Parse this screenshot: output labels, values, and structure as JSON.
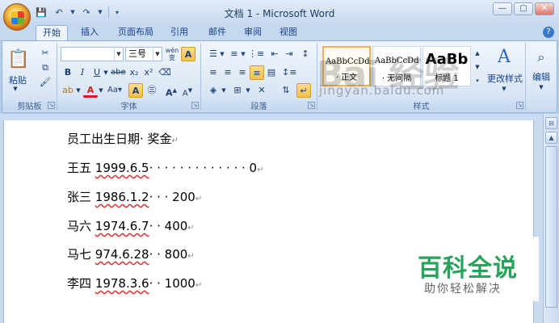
{
  "window": {
    "title": "文档 1 - Microsoft Word",
    "controls": [
      "—",
      "▢",
      "✕"
    ]
  },
  "qat": {
    "save_icon": "save-icon",
    "undo_icon": "undo-icon",
    "redo_icon": "redo-icon",
    "customize_icon": "customize-qat-icon"
  },
  "tabs": [
    "开始",
    "插入",
    "页面布局",
    "引用",
    "邮件",
    "审阅",
    "视图"
  ],
  "active_tab": "开始",
  "ribbon": {
    "clipboard": {
      "label": "剪贴板",
      "paste_label": "粘贴"
    },
    "font": {
      "label": "字体",
      "font_name": "",
      "font_size": "三号",
      "pinyin_glyph": "wén"
    },
    "paragraph": {
      "label": "段落"
    },
    "styles": {
      "label": "样式",
      "items": [
        {
          "sample": "AaBbCcDd",
          "name": "· 正文"
        },
        {
          "sample": "AaBbCcDd",
          "name": "· 无间隔"
        },
        {
          "sample": "AaBb",
          "name": "标题 1"
        }
      ],
      "change_styles_label": "更改样式"
    },
    "editing": {
      "label": "编辑"
    }
  },
  "document": {
    "lines": [
      {
        "pre": "员工出生日期· 奖金",
        "date": "",
        "post": ""
      },
      {
        "pre": "王五 ",
        "date": "1999.6.5",
        "post": "· · · · · · · · · · · · · 0"
      },
      {
        "pre": "张三 ",
        "date": "1986.1.2",
        "post": "· · · 200"
      },
      {
        "pre": "马六 ",
        "date": "1974.6.7",
        "post": "· · 400"
      },
      {
        "pre": "马七 ",
        "date": "974.6.28",
        "post": "· · 800"
      },
      {
        "pre": "李四 ",
        "date": "1978.3.6",
        "post": "· · 1000"
      }
    ],
    "return_mark": "↵"
  },
  "watermarks": {
    "baidu": "Bai 经验",
    "jingyan_url": "jingyan.baidu.com",
    "badge_title": "百科全说",
    "badge_sub": "助你轻松解决"
  },
  "colors": {
    "accent": "#15428b",
    "ribbon_bg": "#dbe7f5",
    "selected_style": "#f2b544",
    "badge_green": "#27a35b"
  }
}
